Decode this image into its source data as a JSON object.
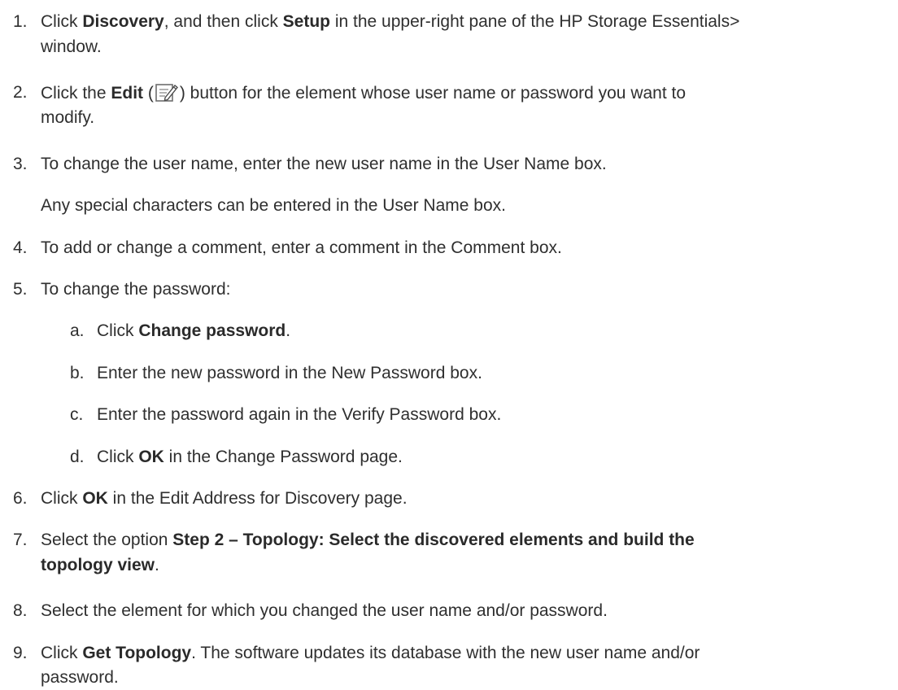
{
  "steps": [
    {
      "number": "1.",
      "pre": "Click ",
      "b1": "Discovery",
      "mid": ", and then click ",
      "b2": "Setup",
      "post": " in the upper-right pane of the HP Storage Essentials>",
      "line2": "window."
    },
    {
      "number": "2.",
      "pre": "Click the ",
      "b1": "Edit",
      "open_paren": " (",
      "icon": "edit-icon",
      "post": ") button for the element whose user name or password you want to",
      "line2": "modify."
    },
    {
      "number": "3.",
      "text": "To change the user name, enter the new user name in the User Name box.",
      "note": "Any special characters can be entered in the User Name box."
    },
    {
      "number": "4.",
      "text": "To add or change a comment, enter a comment in the Comment box."
    },
    {
      "number": "5.",
      "text": "To change the password:",
      "substeps": [
        {
          "letter": "a.",
          "pre": "Click ",
          "b1": "Change password",
          "post": "."
        },
        {
          "letter": "b.",
          "text": "Enter the new password in the New Password box."
        },
        {
          "letter": "c.",
          "text": "Enter the password again in the Verify Password box."
        },
        {
          "letter": "d.",
          "pre": "Click ",
          "b1": "OK",
          "post": " in the Change Password page."
        }
      ]
    },
    {
      "number": "6.",
      "pre": "Click ",
      "b1": "OK",
      "post": " in the Edit Address for Discovery page."
    },
    {
      "number": "7.",
      "pre": "Select the option ",
      "b1": "Step 2 – Topology: Select the discovered elements and build the",
      "b2": "topology view",
      "post": "."
    },
    {
      "number": "8.",
      "text": "Select the element for which you changed the user name and/or password."
    },
    {
      "number": "9.",
      "pre": "Click ",
      "b1": "Get Topology",
      "post": ". The software updates its database with the new user name and/or",
      "line2": "password."
    }
  ]
}
